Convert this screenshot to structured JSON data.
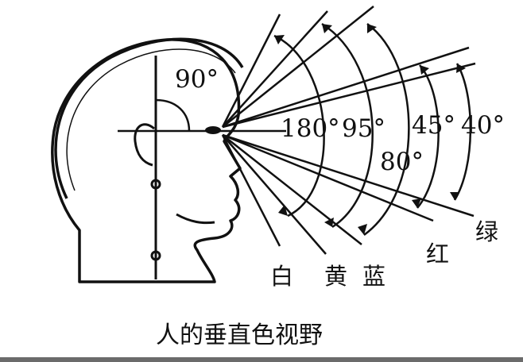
{
  "diagram": {
    "caption": "人的垂直色视野",
    "angles": {
      "vertical_reference": "90°",
      "white": "180°",
      "yellow": "95°",
      "blue": "80°",
      "red": "45°",
      "green": "40°"
    },
    "color_labels": {
      "white": "白",
      "yellow": "黄",
      "blue": "蓝",
      "red": "红",
      "green": "绿"
    },
    "stroke_color": "#111111",
    "background_color": "#ffffff"
  }
}
